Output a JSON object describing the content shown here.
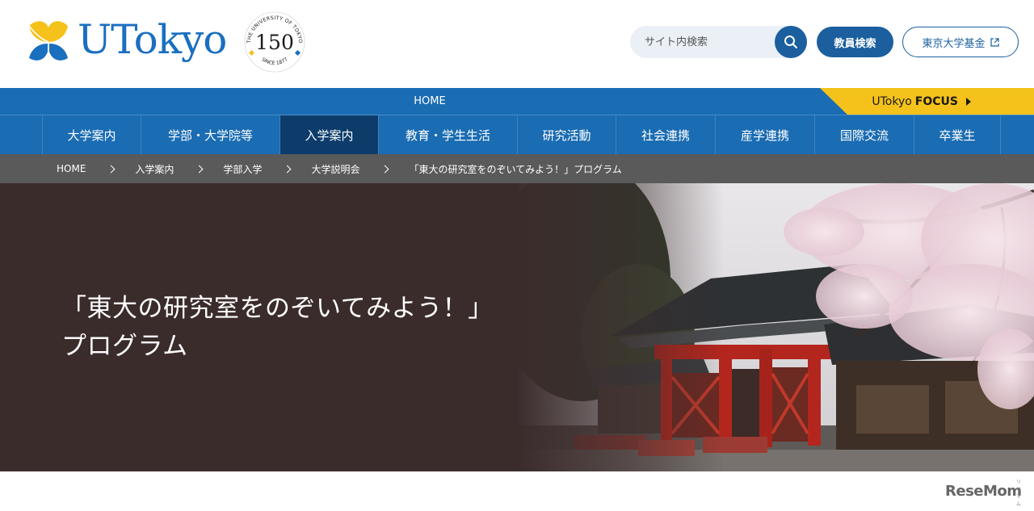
{
  "header": {
    "logo_text": "UTokyo",
    "anniversary": {
      "top_arc": "THE UNIVERSITY OF TOKYO",
      "number": "150",
      "bottom_arc": "SINCE 1877"
    },
    "search": {
      "placeholder": "サイト内検索",
      "icon": "search-icon"
    },
    "staff_search_label": "教員検索",
    "fund_label": "東京大学基金",
    "fund_icon": "external-link-icon",
    "brand_color": "#1a6cb3",
    "accent_color": "#f4c21b"
  },
  "topbar": {
    "home_label": "HOME",
    "focus": {
      "brand": "UTokyo",
      "label": "FOCUS"
    }
  },
  "nav": {
    "items": [
      {
        "label": "大学案内"
      },
      {
        "label": "学部・大学院等"
      },
      {
        "label": "入学案内",
        "active": true
      },
      {
        "label": "教育・学生生活"
      },
      {
        "label": "研究活動"
      },
      {
        "label": "社会連携"
      },
      {
        "label": "産学連携"
      },
      {
        "label": "国際交流"
      },
      {
        "label": "卒業生"
      }
    ]
  },
  "breadcrumb": {
    "items": [
      {
        "label": "HOME"
      },
      {
        "label": "入学案内"
      },
      {
        "label": "学部入学"
      },
      {
        "label": "大学説明会"
      },
      {
        "label": "「東大の研究室をのぞいてみよう！」プログラム"
      }
    ]
  },
  "hero": {
    "title_line1": "「東大の研究室をのぞいてみよう！」",
    "title_line2": "プログラム"
  },
  "watermark": {
    "text": "ReseMom",
    "ruby": "リセマム"
  }
}
